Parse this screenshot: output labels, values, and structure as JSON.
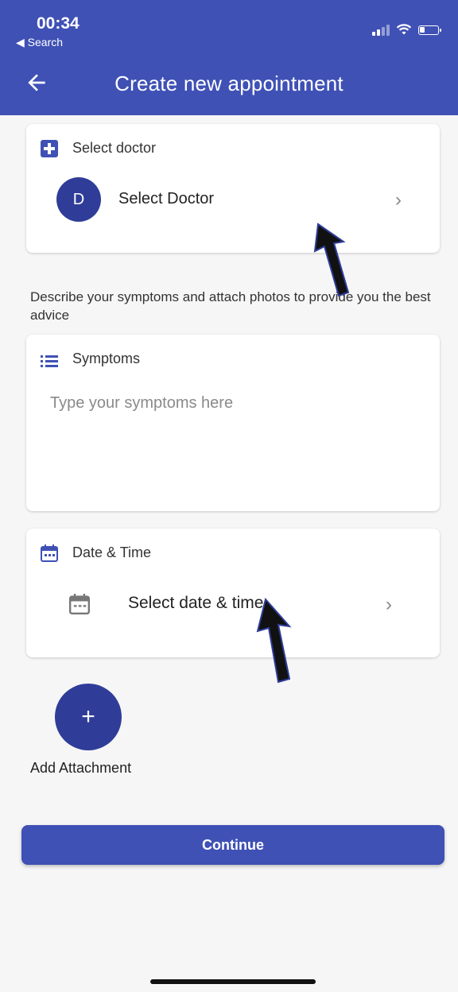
{
  "status_bar": {
    "time": "00:34",
    "back_label": "◀ Search"
  },
  "header": {
    "title": "Create new appointment"
  },
  "doctor_card": {
    "label": "Select doctor",
    "avatar_letter": "D",
    "value": "Select Doctor"
  },
  "description": "Describe your symptoms and attach photos to provide you the best advice",
  "symptoms_card": {
    "label": "Symptoms",
    "placeholder": "Type your symptoms here"
  },
  "datetime_card": {
    "label": "Date & Time",
    "value": "Select date & time"
  },
  "attachment": {
    "label": "Add Attachment"
  },
  "continue_label": "Continue",
  "colors": {
    "primary": "#3f51b5",
    "avatar": "#2f3d99",
    "background": "#f6f6f6"
  }
}
